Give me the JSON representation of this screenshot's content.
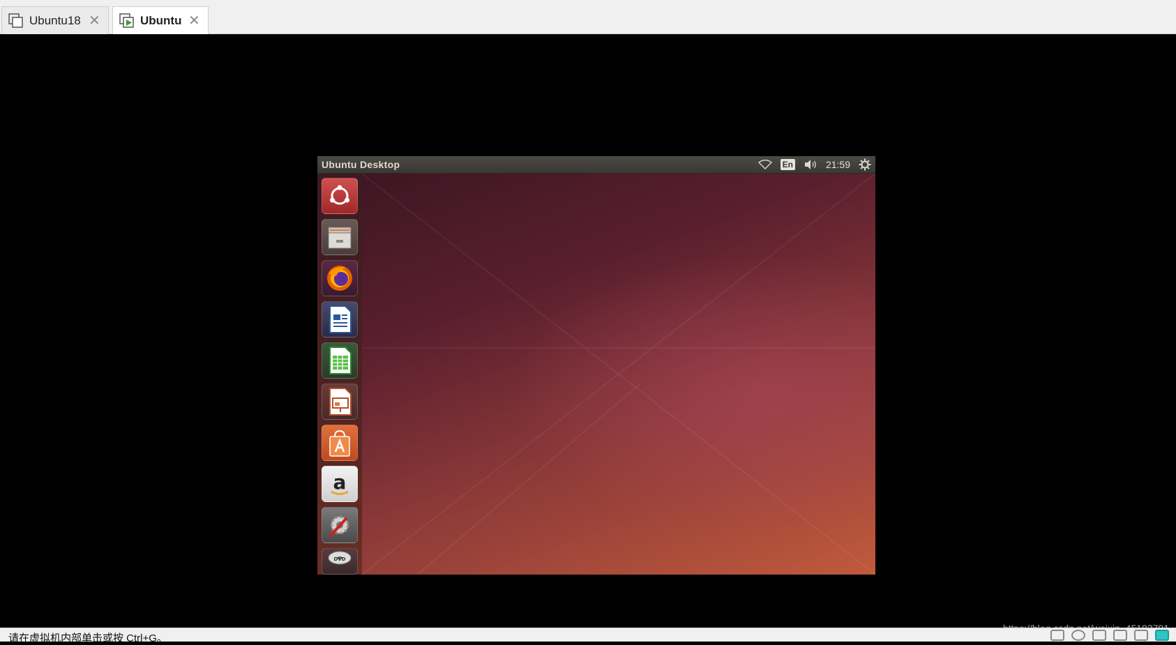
{
  "tabs": [
    {
      "label": "Ubuntu18",
      "close": "✕",
      "active": false
    },
    {
      "label": "Ubuntu",
      "close": "✕",
      "active": true
    }
  ],
  "guest": {
    "topbar": {
      "title": "Ubuntu Desktop",
      "input_method": "En",
      "clock": "21:59"
    },
    "launcher": [
      {
        "name": "dash",
        "icon": "ubuntu-logo-icon"
      },
      {
        "name": "files",
        "icon": "file-cabinet-icon"
      },
      {
        "name": "firefox",
        "icon": "firefox-icon"
      },
      {
        "name": "writer",
        "icon": "libreoffice-writer-icon"
      },
      {
        "name": "calc",
        "icon": "libreoffice-calc-icon"
      },
      {
        "name": "impress",
        "icon": "libreoffice-impress-icon"
      },
      {
        "name": "software-center",
        "icon": "shopping-bag-icon"
      },
      {
        "name": "amazon",
        "icon": "amazon-icon"
      },
      {
        "name": "system-settings",
        "icon": "settings-wrench-icon"
      },
      {
        "name": "dvd",
        "icon": "dvd-icon"
      }
    ]
  },
  "statusbar": {
    "message": "请在虚拟机内部单击或按 Ctrl+G。"
  },
  "watermark": "https://blog.csdn.net/weixin_45193791",
  "colors": {
    "desktop_dark": "#3e1623",
    "desktop_light": "#c05a3c",
    "topbar": "#3a3834",
    "launch_accent": "#b8302f"
  }
}
